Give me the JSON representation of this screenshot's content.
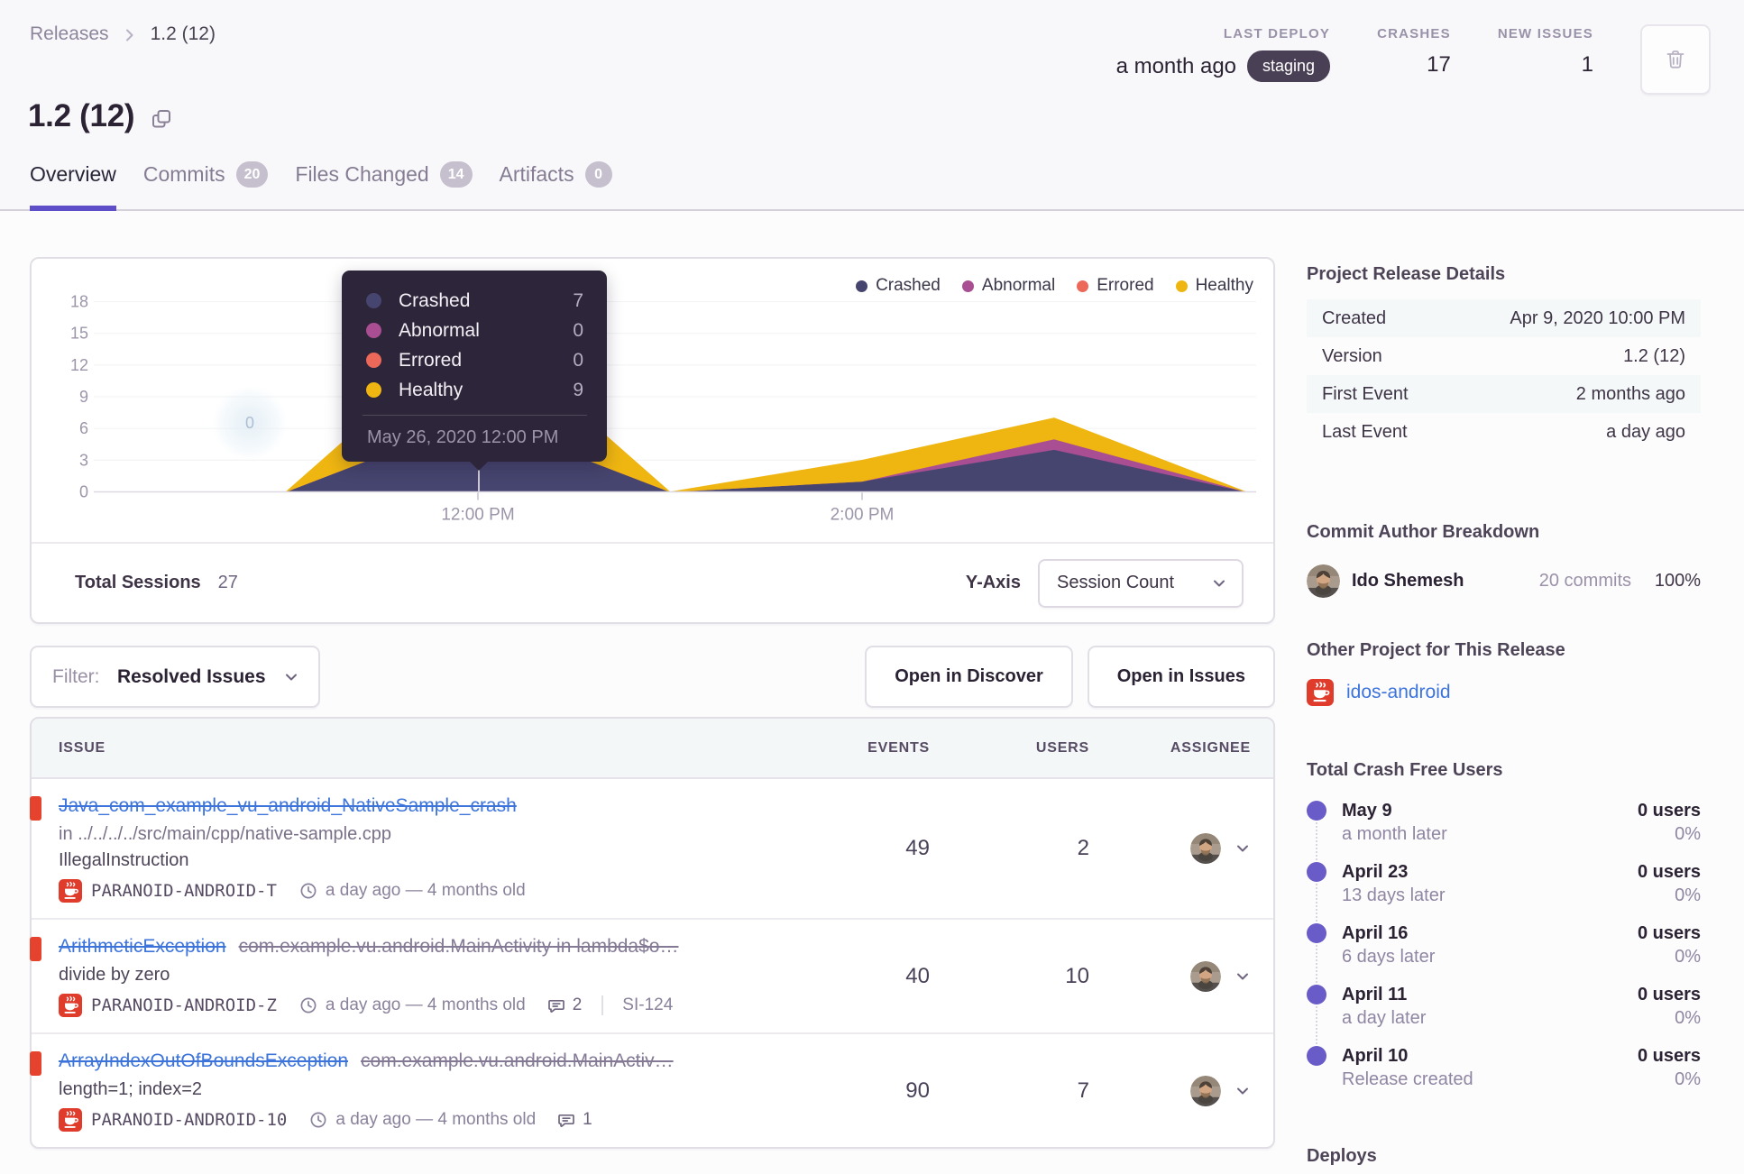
{
  "breadcrumb": {
    "parent": "Releases",
    "current": "1.2 (12)"
  },
  "header": {
    "title": "1.2 (12)",
    "stats": {
      "last_deploy": {
        "label": "LAST DEPLOY",
        "value": "a month ago",
        "env": "staging"
      },
      "crashes": {
        "label": "CRASHES",
        "value": "17"
      },
      "new_issues": {
        "label": "NEW ISSUES",
        "value": "1"
      }
    },
    "tabs": [
      {
        "label": "Overview",
        "active": true
      },
      {
        "label": "Commits",
        "count": "20"
      },
      {
        "label": "Files Changed",
        "count": "14"
      },
      {
        "label": "Artifacts",
        "count": "0"
      }
    ]
  },
  "chart_panel": {
    "total_sessions_label": "Total Sessions",
    "total_sessions_value": "27",
    "y_axis_label": "Y-Axis",
    "y_axis_value": "Session Count"
  },
  "chart_data": {
    "type": "area",
    "stacked": true,
    "x": [
      "10:00 AM",
      "11:00 AM",
      "12:00 PM",
      "1:00 PM",
      "2:00 PM",
      "3:00 PM",
      "4:00 PM"
    ],
    "x_tick_indices": [
      2,
      4
    ],
    "ylim": [
      0,
      18
    ],
    "yticks": [
      0,
      3,
      6,
      9,
      12,
      15,
      18
    ],
    "grid": true,
    "legend_position": "top-right",
    "series": [
      {
        "name": "Crashed",
        "color": "#46456F",
        "values": [
          0,
          0,
          7,
          0,
          1,
          4,
          0
        ]
      },
      {
        "name": "Abnormal",
        "color": "#A94E92",
        "values": [
          0,
          0,
          0,
          0,
          0,
          1,
          0
        ]
      },
      {
        "name": "Errored",
        "color": "#EC6858",
        "values": [
          0,
          0,
          0,
          0,
          0,
          0,
          0
        ]
      },
      {
        "name": "Healthy",
        "color": "#EFB611",
        "values": [
          0,
          0,
          9,
          0,
          2,
          2,
          0
        ]
      }
    ],
    "tooltip": {
      "x_index": 2,
      "title": "May 26, 2020 12:00 PM",
      "rows": [
        {
          "name": "Crashed",
          "value": "7"
        },
        {
          "name": "Abnormal",
          "value": "0"
        },
        {
          "name": "Errored",
          "value": "0"
        },
        {
          "name": "Healthy",
          "value": "9"
        }
      ]
    },
    "ghost_label": "0"
  },
  "toolbar": {
    "filter_label": "Filter:",
    "filter_value": "Resolved Issues",
    "discover_button": "Open in Discover",
    "issues_button": "Open in Issues"
  },
  "issues_table": {
    "columns": [
      "ISSUE",
      "EVENTS",
      "USERS",
      "ASSIGNEE"
    ],
    "rows": [
      {
        "title": "Java_com_example_vu_android_NativeSample_crash",
        "culprit": null,
        "location": "in ../../../../src/main/cpp/native-sample.cpp",
        "message": "IllegalInstruction",
        "project": "PARANOID-ANDROID-T",
        "age": "a day ago — 4 months old",
        "comments": null,
        "ref": null,
        "events": "49",
        "users": "2"
      },
      {
        "title": "ArithmeticException",
        "culprit": "com.example.vu.android.MainActivity in lambda$o…",
        "location": null,
        "message": "divide by zero",
        "project": "PARANOID-ANDROID-Z",
        "age": "a day ago — 4 months old",
        "comments": "2",
        "ref": "SI-124",
        "events": "40",
        "users": "10"
      },
      {
        "title": "ArrayIndexOutOfBoundsException",
        "culprit": "com.example.vu.android.MainActiv…",
        "location": null,
        "message": "length=1; index=2",
        "project": "PARANOID-ANDROID-10",
        "age": "a day ago — 4 months old",
        "comments": "1",
        "ref": null,
        "events": "90",
        "users": "7"
      }
    ]
  },
  "sidebar": {
    "details": {
      "heading": "Project Release Details",
      "rows": [
        {
          "label": "Created",
          "value": "Apr 9, 2020 10:00 PM"
        },
        {
          "label": "Version",
          "value": "1.2 (12)"
        },
        {
          "label": "First Event",
          "value": "2 months ago"
        },
        {
          "label": "Last Event",
          "value": "a day ago"
        }
      ]
    },
    "authors": {
      "heading": "Commit Author Breakdown",
      "name": "Ido Shemesh",
      "commits": "20 commits",
      "percent": "100%"
    },
    "other_project": {
      "heading": "Other Project for This Release",
      "project": "idos-android"
    },
    "crash_free": {
      "heading": "Total Crash Free Users",
      "items": [
        {
          "date": "May 9",
          "desc": "a month later",
          "users": "0 users",
          "percent": "0%"
        },
        {
          "date": "April 23",
          "desc": "13 days later",
          "users": "0 users",
          "percent": "0%"
        },
        {
          "date": "April 16",
          "desc": "6 days later",
          "users": "0 users",
          "percent": "0%"
        },
        {
          "date": "April 11",
          "desc": "a day later",
          "users": "0 users",
          "percent": "0%"
        },
        {
          "date": "April 10",
          "desc": "Release created",
          "users": "0 users",
          "percent": "0%"
        }
      ]
    },
    "deploys_heading": "Deploys"
  }
}
